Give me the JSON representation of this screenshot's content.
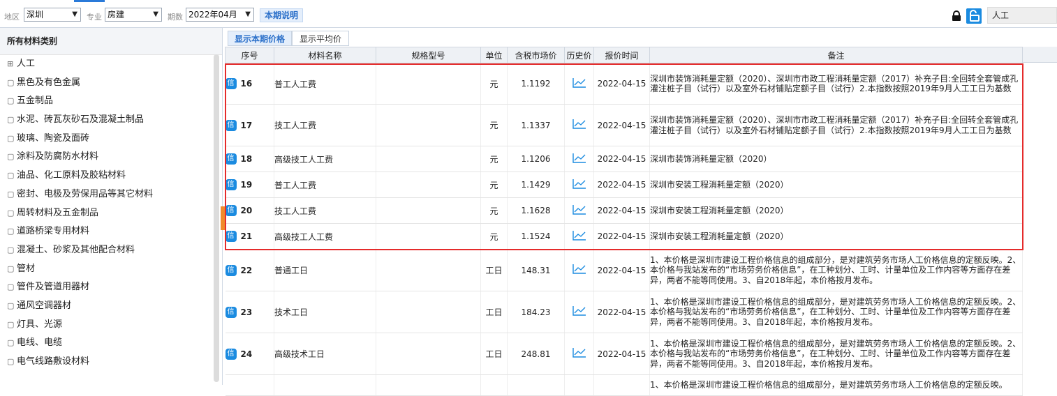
{
  "filters": {
    "region_label": "地区",
    "region_value": "深圳",
    "major_label": "专业",
    "major_value": "房建",
    "period_label": "期数",
    "period_value": "2022年04月",
    "explain_label": "本期说明"
  },
  "search": {
    "value": "人工"
  },
  "colors": {
    "accent": "#1b8be0",
    "highlight_border": "#e52b2b",
    "handle": "#f08b2c"
  },
  "sidebar": {
    "header": "所有材料类别",
    "items": [
      {
        "icon": "expand-icon",
        "label": "人工"
      },
      {
        "icon": "file-icon",
        "label": "黑色及有色金属"
      },
      {
        "icon": "file-icon",
        "label": "五金制品"
      },
      {
        "icon": "file-icon",
        "label": "水泥、砖瓦灰砂石及混凝土制品"
      },
      {
        "icon": "file-icon",
        "label": "玻璃、陶瓷及面砖"
      },
      {
        "icon": "file-icon",
        "label": "涂料及防腐防水材料"
      },
      {
        "icon": "file-icon",
        "label": "油品、化工原料及胶粘材料"
      },
      {
        "icon": "file-icon",
        "label": "密封、电极及劳保用品等其它材料"
      },
      {
        "icon": "file-icon",
        "label": "周转材料及五金制品"
      },
      {
        "icon": "file-icon",
        "label": "道路桥梁专用材料"
      },
      {
        "icon": "file-icon",
        "label": "混凝土、砂浆及其他配合材料"
      },
      {
        "icon": "file-icon",
        "label": "管材"
      },
      {
        "icon": "file-icon",
        "label": "管件及管道用器材"
      },
      {
        "icon": "file-icon",
        "label": "通风空调器材"
      },
      {
        "icon": "file-icon",
        "label": "灯具、光源"
      },
      {
        "icon": "file-icon",
        "label": "电线、电缆"
      },
      {
        "icon": "file-icon",
        "label": "电气线路敷设材料"
      }
    ]
  },
  "tabs": [
    {
      "label": "显示本期价格",
      "active": true
    },
    {
      "label": "显示平均价",
      "active": false
    }
  ],
  "table": {
    "columns": [
      "序号",
      "材料名称",
      "规格型号",
      "单位",
      "含税市场价",
      "历史价",
      "报价时间",
      "备注"
    ],
    "badge": "信",
    "rows": [
      {
        "seq": "16",
        "name": "普工人工费",
        "spec": "",
        "unit": "元",
        "price": "1.1192",
        "time": "2022-04-15",
        "note": "深圳市装饰消耗量定额（2020）、深圳市市政工程消耗量定额（2017）补充子目:全回转全套管成孔灌注桩子目（试行）以及室外石材铺贴定额子目（试行）2.本指数按照2019年9月人工工日为基数"
      },
      {
        "seq": "17",
        "name": "技工人工费",
        "spec": "",
        "unit": "元",
        "price": "1.1337",
        "time": "2022-04-15",
        "note": "深圳市装饰消耗量定额（2020）、深圳市市政工程消耗量定额（2017）补充子目:全回转全套管成孔灌注桩子目（试行）以及室外石材铺贴定额子目（试行）2.本指数按照2019年9月人工工日为基数"
      },
      {
        "seq": "18",
        "name": "高级技工人工费",
        "spec": "",
        "unit": "元",
        "price": "1.1206",
        "time": "2022-04-15",
        "note": "深圳市装饰消耗量定额（2020）"
      },
      {
        "seq": "19",
        "name": "普工人工费",
        "spec": "",
        "unit": "元",
        "price": "1.1429",
        "time": "2022-04-15",
        "note": "深圳市安装工程消耗量定额（2020）"
      },
      {
        "seq": "20",
        "name": "技工人工费",
        "spec": "",
        "unit": "元",
        "price": "1.1628",
        "time": "2022-04-15",
        "note": "深圳市安装工程消耗量定额（2020）"
      },
      {
        "seq": "21",
        "name": "高级技工人工费",
        "spec": "",
        "unit": "元",
        "price": "1.1524",
        "time": "2022-04-15",
        "note": "深圳市安装工程消耗量定额（2020）"
      },
      {
        "seq": "22",
        "name": "普通工日",
        "spec": "",
        "unit": "工日",
        "price": "148.31",
        "time": "2022-04-15",
        "note": "1、本价格是深圳市建设工程价格信息的组成部分，是对建筑劳务市场人工价格信息的定额反映。2、本价格与我站发布的“市场劳务价格信息”，在工种划分、工时、计量单位及工作内容等方面存在差异，两者不能等同使用。3、自2018年起，本价格按月发布。"
      },
      {
        "seq": "23",
        "name": "技术工日",
        "spec": "",
        "unit": "工日",
        "price": "184.23",
        "time": "2022-04-15",
        "note": "1、本价格是深圳市建设工程价格信息的组成部分，是对建筑劳务市场人工价格信息的定额反映。2、本价格与我站发布的“市场劳务价格信息”，在工种划分、工时、计量单位及工作内容等方面存在差异，两者不能等同使用。3、自2018年起，本价格按月发布。"
      },
      {
        "seq": "24",
        "name": "高级技术工日",
        "spec": "",
        "unit": "工日",
        "price": "248.81",
        "time": "2022-04-15",
        "note": "1、本价格是深圳市建设工程价格信息的组成部分，是对建筑劳务市场人工价格信息的定额反映。2、本价格与我站发布的“市场劳务价格信息”，在工种划分、工时、计量单位及工作内容等方面存在差异，两者不能等同使用。3、自2018年起，本价格按月发布。"
      },
      {
        "seq": "",
        "name": "",
        "spec": "",
        "unit": "",
        "price": "",
        "time": "",
        "note": "1、本价格是深圳市建设工程价格信息的组成部分，是对建筑劳务市场人工价格信息的定额反映。"
      }
    ]
  }
}
